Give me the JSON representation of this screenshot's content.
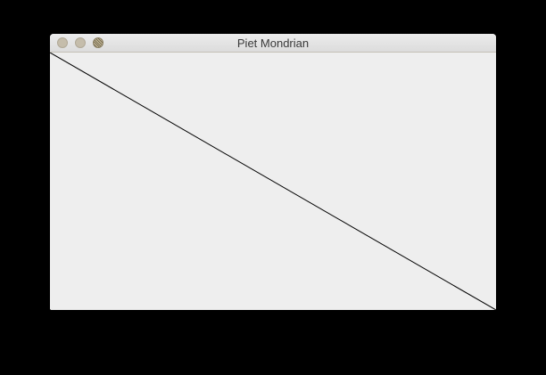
{
  "window": {
    "title": "Piet Mondrian"
  },
  "colors": {
    "desktop": "#000000",
    "content_background": "#eeeeee",
    "line": "#000000"
  },
  "icons": {
    "close": "close-button",
    "minimize": "minimize-button",
    "zoom": "zoom-button"
  }
}
